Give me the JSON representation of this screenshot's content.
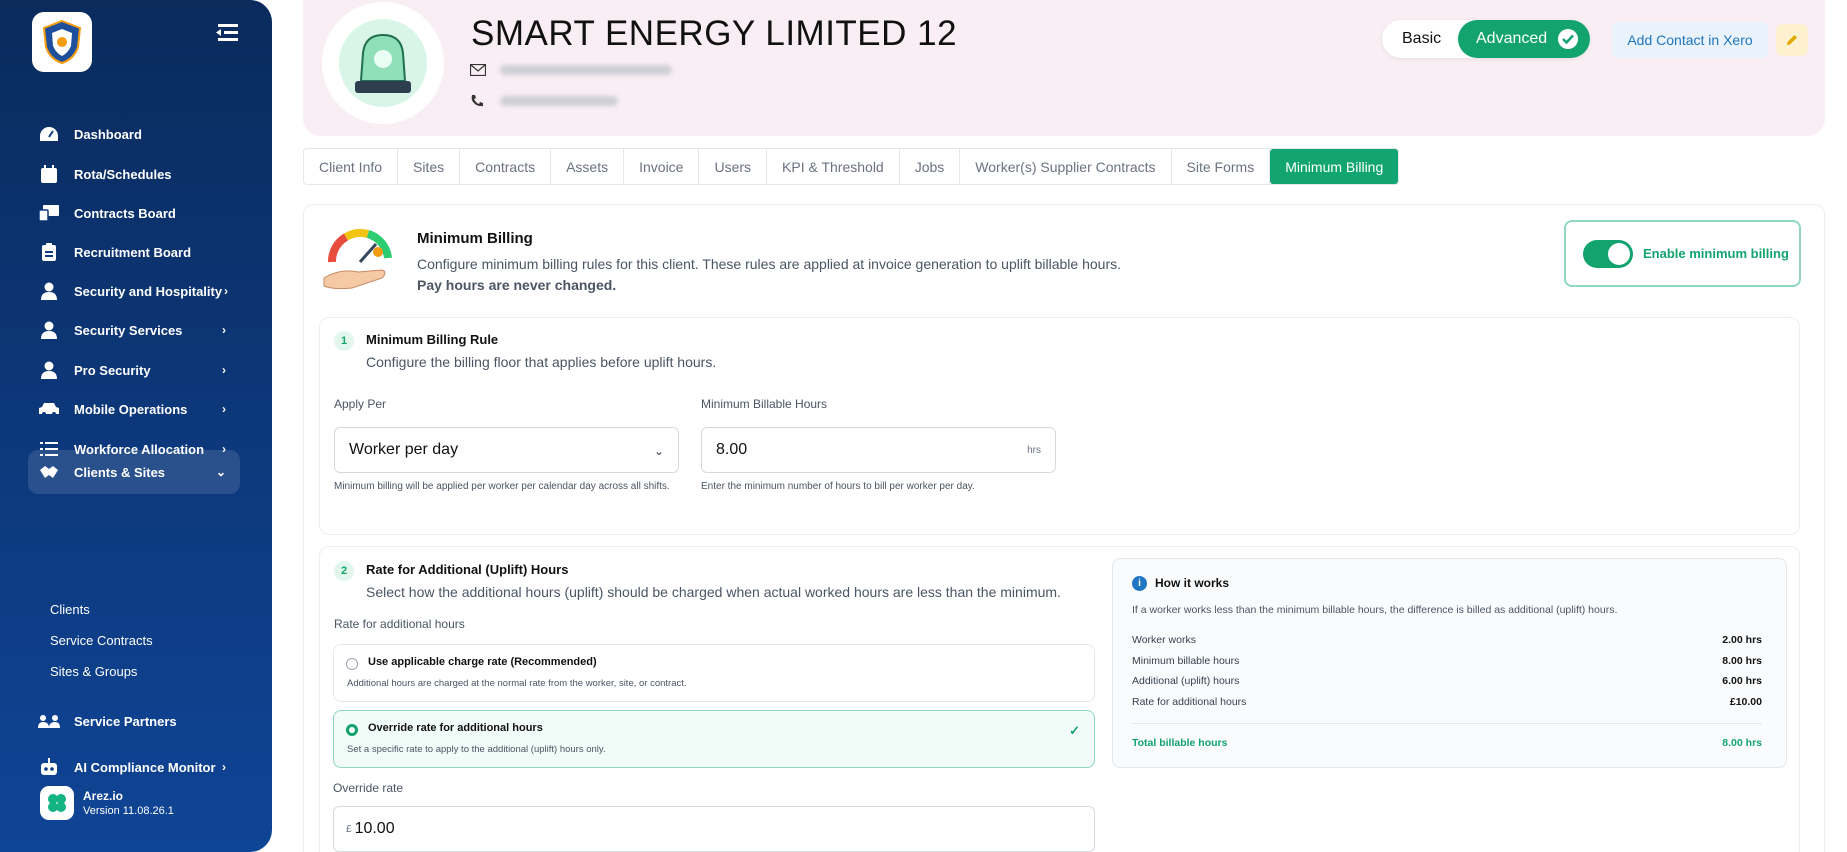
{
  "sidebar": {
    "items": [
      {
        "label": "Dashboard",
        "icon": "dashboard-icon",
        "chevron": false
      },
      {
        "label": "Rota/Schedules",
        "icon": "calendar-icon",
        "chevron": false
      },
      {
        "label": "Contracts Board",
        "icon": "contracts-icon",
        "chevron": false
      },
      {
        "label": "Recruitment Board",
        "icon": "clipboard-icon",
        "chevron": false
      },
      {
        "label": "Security and Hospitality",
        "icon": "user-icon",
        "chevron": true
      },
      {
        "label": "Security Services",
        "icon": "user-icon",
        "chevron": true
      },
      {
        "label": "Pro Security",
        "icon": "user-icon",
        "chevron": true
      },
      {
        "label": "Mobile Operations",
        "icon": "car-icon",
        "chevron": true
      },
      {
        "label": "Workforce Allocation",
        "icon": "list-icon",
        "chevron": true
      },
      {
        "label": "Clients & Sites",
        "icon": "handshake-icon",
        "chevron": true
      },
      {
        "label": "Service Partners",
        "icon": "partners-icon",
        "chevron": false
      },
      {
        "label": "AI Compliance Monitor",
        "icon": "robot-icon",
        "chevron": true
      }
    ],
    "sub_items": [
      "Clients",
      "Service Contracts",
      "Sites & Groups"
    ],
    "app_name": "Arez.io",
    "app_version": "Version 11.08.26.1"
  },
  "header": {
    "company": "SMART ENERGY LIMITED 12",
    "mode_basic": "Basic",
    "mode_advanced": "Advanced",
    "xero_button": "Add Contact in Xero"
  },
  "tabs": [
    "Client Info",
    "Sites",
    "Contracts",
    "Assets",
    "Invoice",
    "Users",
    "KPI & Threshold",
    "Jobs",
    "Worker(s) Supplier Contracts",
    "Site Forms",
    "Minimum Billing"
  ],
  "active_tab": "Minimum Billing",
  "minimum_billing": {
    "title": "Minimum Billing",
    "description": "Configure minimum billing rules for this client. These rules are applied at invoice generation to uplift billable hours.",
    "note": "Pay hours are never changed.",
    "enable_label": "Enable minimum billing",
    "enabled": true
  },
  "rule": {
    "step": "1",
    "title": "Minimum Billing Rule",
    "description": "Configure the billing floor that applies before uplift hours.",
    "apply_per_label": "Apply Per",
    "apply_per_value": "Worker per day",
    "apply_per_hint": "Minimum billing will be applied per worker per calendar day across all shifts.",
    "min_hours_label": "Minimum Billable Hours",
    "min_hours_value": "8.00",
    "min_hours_unit": "hrs",
    "min_hours_hint": "Enter the minimum number of hours to bill per worker per day."
  },
  "uplift": {
    "step": "2",
    "title": "Rate for Additional (Uplift) Hours",
    "description": "Select how the additional hours (uplift) should be charged when actual worked hours are less than the minimum.",
    "rate_label": "Rate for additional hours",
    "options": [
      {
        "title": "Use applicable charge rate (Recommended)",
        "desc": "Additional hours are charged at the normal rate from the worker, site, or contract.",
        "selected": false
      },
      {
        "title": "Override rate for additional hours",
        "desc": "Set a specific rate to apply to the additional (uplift) hours only.",
        "selected": true
      }
    ],
    "override_label": "Override rate",
    "currency": "£",
    "override_value": "10.00"
  },
  "how_it_works": {
    "title": "How it works",
    "description": "If a worker works less than the minimum billable hours, the difference is billed as additional (uplift) hours.",
    "rows": [
      {
        "label": "Worker works",
        "value": "2.00 hrs"
      },
      {
        "label": "Minimum billable hours",
        "value": "8.00 hrs"
      },
      {
        "label": "Additional (uplift) hours",
        "value": "6.00 hrs"
      },
      {
        "label": "Rate for additional hours",
        "value": "£10.00"
      }
    ],
    "total_label": "Total billable hours",
    "total_value": "8.00 hrs"
  },
  "colors": {
    "accent": "#13a36f",
    "sidebar": "#0d3a80",
    "link": "#1f76c2"
  }
}
